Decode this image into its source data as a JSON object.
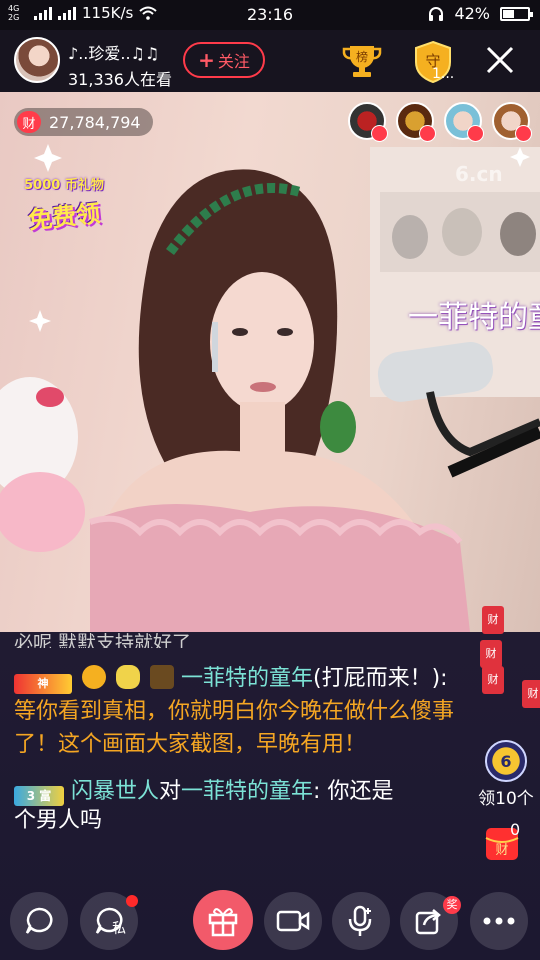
{
  "status_bar": {
    "network_top": "4G",
    "network_bottom": "2G",
    "speed": "115K/s",
    "time": "23:16",
    "battery": "42%",
    "battery_level": 0.42
  },
  "header": {
    "host_name": "♪..珍爱..♫♫",
    "viewer_count": "31,336人在看",
    "follow_label": "关注",
    "follow_plus": "+",
    "rank_label": "榜",
    "guard_label": "守",
    "guard_count": "1..."
  },
  "video": {
    "wealth_icon": "财",
    "wealth_value": "27,784,794",
    "promo_top": "5000 币礼物",
    "promo_main": "免费领",
    "watermark": "6.cn",
    "scroll_text": "一菲特的童"
  },
  "chat": {
    "partial_top": "必呢 默默支持就好了",
    "msg1": {
      "badge_text": "神",
      "sender": "一菲特的童年",
      "sender_suffix": "(打屁而来！):",
      "text": " 等你看到真相，你就明白你今晚在做什么傻事了！这个画面大家截图，早晚有用！"
    },
    "msg2": {
      "badge_text": "3 富",
      "sender": "闪暴世人",
      "connector": "对",
      "target": "一菲特的童年",
      "text": ": 你还是"
    },
    "partial_bottom": "个男人吗"
  },
  "side": {
    "float_red_label": "财",
    "receive_coin": "6",
    "receive_label": "领10个",
    "redpack_icon": "财",
    "redpack_count": "0"
  },
  "bottom": {
    "private_label": "私",
    "prize_label": "奖"
  },
  "colors": {
    "accent_red": "#ff3b4a",
    "chat_name": "#7ce3d6",
    "chat_gold": "#f5a623"
  }
}
